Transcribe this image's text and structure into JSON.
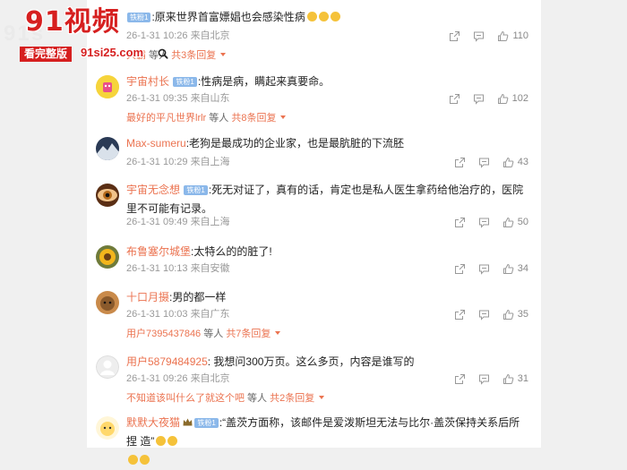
{
  "watermark": {
    "title": "91视频",
    "tag": "看完整版",
    "url": "91si25.com",
    "bg": "91s"
  },
  "comments": [
    {
      "name": "",
      "badge": "铁粉1",
      "text": ":原来世界首富嫖娼也会感染性病",
      "emojis": 3,
      "date": "26-1-31 10:26",
      "location": "来自北京",
      "shares": "",
      "comments": "",
      "likes": "110",
      "reply_user": "大霸",
      "reply_mid": " 等人 ",
      "reply_count": "共3条回复"
    },
    {
      "name": "宇宙村长",
      "badge": "铁粉1",
      "text": ":性病是病，瞒起来真要命。",
      "date": "26-1-31 09:35",
      "location": "来自山东",
      "likes": "102",
      "reply_user": "最好的平凡世界lrlr",
      "reply_mid": " 等人 ",
      "reply_count": "共8条回复"
    },
    {
      "name": "Max-sumeru",
      "text": ":老狗是最成功的企业家，也是最肮脏的下流胚",
      "date": "26-1-31 10:29",
      "location": "来自上海",
      "likes": "43"
    },
    {
      "name": "宇宙无念想",
      "badge": "铁粉1",
      "text": ":死无对证了，真有的话，肯定也是私人医生拿药给他治疗的，医院里不可能有记录。",
      "date": "26-1-31 09:49",
      "location": "来自上海",
      "likes": "50"
    },
    {
      "name": "布鲁塞尔城堡",
      "text": ":太特么的的脏了!",
      "date": "26-1-31 10:13",
      "location": "来自安徽",
      "likes": "34"
    },
    {
      "name": "十口月摄",
      "text": ":男的都一样",
      "date": "26-1-31 10:03",
      "location": "来自广东",
      "likes": "35",
      "reply_user": "用户7395437846",
      "reply_mid": " 等人 ",
      "reply_count": "共7条回复"
    },
    {
      "name": "用户5879484925",
      "text": ": 我想问300万页。这么多页，内容是谁写的",
      "date": "26-1-31 09:26",
      "location": "来自北京",
      "likes": "31",
      "reply_user": "不知道该叫什么了就这个吧",
      "reply_mid": " 等人 ",
      "reply_count": "共2条回复"
    },
    {
      "name": "默默大夜猫",
      "badge": "铁粉1",
      "text": ":“盖茨方面称，该邮件是爱泼斯坦无法与比尔·盖茨保持关系后所捏 造”"
    }
  ],
  "colors": {
    "accent": "#eb7350",
    "badge": "#8bb8ea",
    "watermark": "#d61f1f"
  }
}
